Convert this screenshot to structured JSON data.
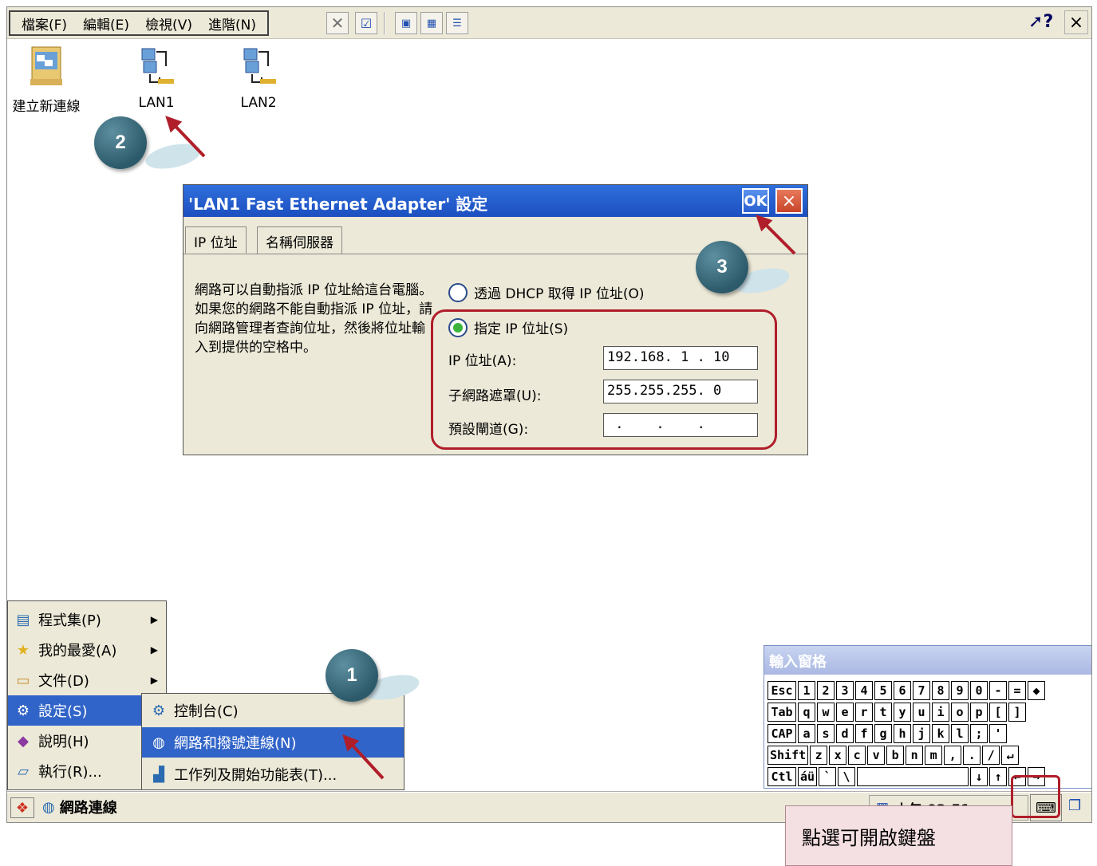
{
  "menubar": {
    "items": [
      "檔案(F)",
      "編輯(E)",
      "檢視(V)",
      "進階(N)"
    ],
    "help_label": "?",
    "close_label": "×"
  },
  "desktop": {
    "icons": [
      {
        "label": "建立新連線",
        "icon": "new-connection-icon"
      },
      {
        "label": "LAN1",
        "icon": "network-adapter-icon"
      },
      {
        "label": "LAN2",
        "icon": "network-adapter-icon"
      }
    ]
  },
  "annotations": {
    "step1": "1",
    "step2": "2",
    "step3": "3",
    "callout": "點選可開啟鍵盤"
  },
  "dialog": {
    "title": "'LAN1 Fast Ethernet Adapter' 設定",
    "ok_label": "OK",
    "close_label": "×",
    "tabs": [
      "IP 位址",
      "名稱伺服器"
    ],
    "description": "網路可以自動指派 IP 位址給這台電腦。如果您的網路不能自動指派 IP 位址，請向網路管理者查詢位址，然後將位址輸入到提供的空格中。",
    "radio_dhcp": "透過 DHCP 取得 IP 位址(O)",
    "radio_static": "指定 IP 位址(S)",
    "ip_label": "IP 位址(A):",
    "ip_value": "192.168. 1 . 10",
    "subnet_label": "子網路遮罩(U):",
    "subnet_value": "255.255.255. 0",
    "gateway_label": "預設閘道(G):",
    "gateway_value": " .    .    . "
  },
  "start_menu": {
    "items": [
      {
        "label": "程式集(P)",
        "icon": "programs-icon",
        "has_submenu": true
      },
      {
        "label": "我的最愛(A)",
        "icon": "favorites-icon",
        "has_submenu": true
      },
      {
        "label": "文件(D)",
        "icon": "documents-icon",
        "has_submenu": true
      },
      {
        "label": "設定(S)",
        "icon": "settings-icon",
        "has_submenu": true
      },
      {
        "label": "說明(H)",
        "icon": "help-book-icon",
        "has_submenu": false
      },
      {
        "label": "執行(R)...",
        "icon": "run-icon",
        "has_submenu": false
      }
    ],
    "submenu": [
      {
        "label": "控制台(C)",
        "icon": "control-panel-icon"
      },
      {
        "label": "網路和撥號連線(N)",
        "icon": "network-dialup-icon"
      },
      {
        "label": "工作列及開始功能表(T)...",
        "icon": "taskbar-icon"
      }
    ]
  },
  "taskbar": {
    "task_label": "網路連線",
    "tray_text": "上午 03:51"
  },
  "input_panel": {
    "title": "輸入窗格",
    "rows": [
      [
        "Esc",
        "1",
        "2",
        "3",
        "4",
        "5",
        "6",
        "7",
        "8",
        "9",
        "0",
        "-",
        "=",
        "◆"
      ],
      [
        "Tab",
        "q",
        "w",
        "e",
        "r",
        "t",
        "y",
        "u",
        "i",
        "o",
        "p",
        "[",
        "]"
      ],
      [
        "CAP",
        "a",
        "s",
        "d",
        "f",
        "g",
        "h",
        "j",
        "k",
        "l",
        ";",
        "'"
      ],
      [
        "Shift",
        "z",
        "x",
        "c",
        "v",
        "b",
        "n",
        "m",
        ",",
        ".",
        "/",
        "↵"
      ],
      [
        "Ctl",
        "áü",
        "`",
        "\\",
        "",
        "↓",
        "↑",
        "←",
        "→"
      ]
    ]
  },
  "colors": {
    "accent_red": "#b01e2a",
    "selection_blue": "#3164c8",
    "titlebar_blue": "#1c4fc0",
    "badge_teal": "#2c5a6a"
  }
}
